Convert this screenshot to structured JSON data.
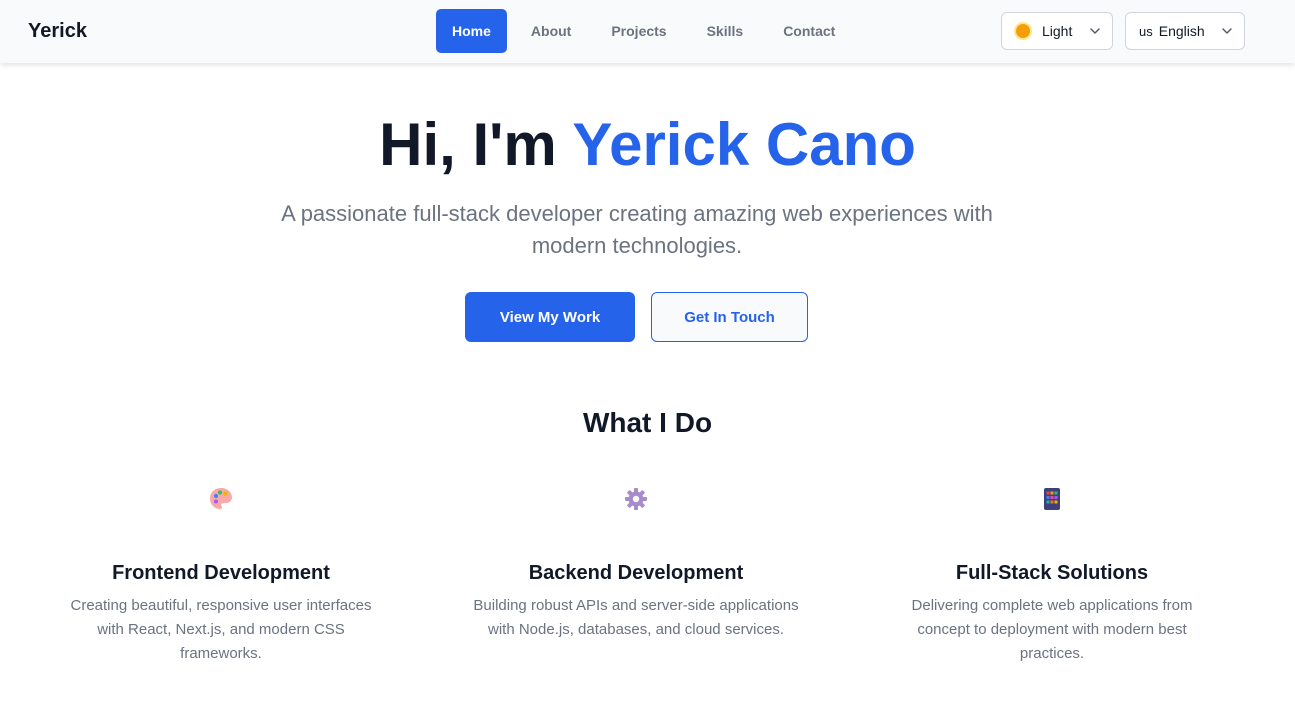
{
  "nav": {
    "brand": "Yerick",
    "links": [
      "Home",
      "About",
      "Projects",
      "Skills",
      "Contact"
    ],
    "active_link": "Home",
    "theme_select": {
      "icon": "sun-icon",
      "value": "Light"
    },
    "language_select": {
      "flag": "us",
      "value": "English"
    }
  },
  "hero": {
    "greeting": "Hi, I'm",
    "name": "Yerick Cano",
    "subtitle": "A passionate full-stack developer creating amazing web experiences with modern technologies.",
    "primary_button": "View My Work",
    "secondary_button": "Get In Touch"
  },
  "services": {
    "title": "What I Do",
    "items": [
      {
        "icon": "palette-icon",
        "title": "Frontend Development",
        "description": "Creating beautiful, responsive user interfaces with React, Next.js, and modern CSS frameworks."
      },
      {
        "icon": "gear-icon",
        "title": "Backend Development",
        "description": "Building robust APIs and server-side applications with Node.js, databases, and cloud services."
      },
      {
        "icon": "mobile-app-icon",
        "title": "Full-Stack Solutions",
        "description": "Delivering complete web applications from concept to deployment with modern best practices."
      }
    ]
  },
  "colors": {
    "accent": "#2563eb",
    "text_primary": "#111827",
    "text_muted": "#6b7280",
    "navbar_bg": "#f9fafb"
  }
}
